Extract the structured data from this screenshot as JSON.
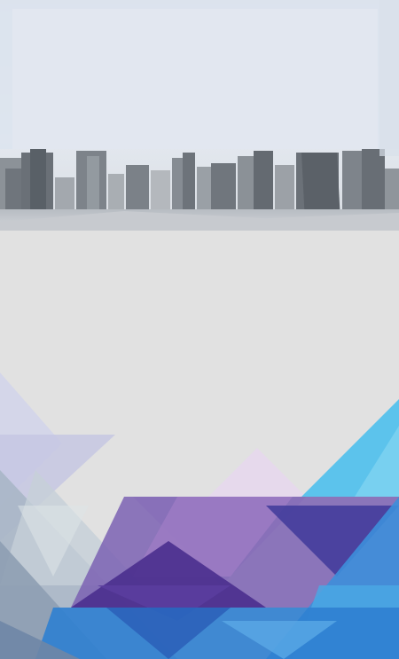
{
  "colors": {
    "page_background": "#e1e1e1",
    "sky_top": "#d6dde7",
    "sky_bottom": "#eef1f5",
    "haze_panel": "#dde4ee",
    "building_dark": "#5f656c",
    "building_mid": "#8a9097",
    "building_light": "#aeb3b8",
    "accent_blue": "#2f7fd0",
    "accent_cyan": "#5cc3ec",
    "accent_purple": "#5a3d9e",
    "accent_violet": "#8b5fb8",
    "accent_lavender": "#c9b8dc",
    "accent_grey_blue": "#8e9fb2"
  },
  "regions": {
    "banner": "city-skyline-photo",
    "middle": "blank-grey-area",
    "bottom": "low-poly-triangle-pattern"
  }
}
